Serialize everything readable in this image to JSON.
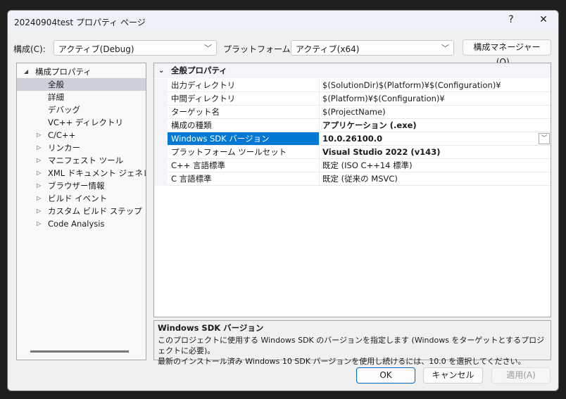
{
  "window": {
    "title": "20240904test プロパティ ページ",
    "help": "?",
    "close": "✕"
  },
  "config": {
    "label": "構成(C):",
    "value": "アクティブ(Debug)",
    "platform_label": "プラットフォーム(P):",
    "platform_value": "アクティブ(x64)",
    "manager_button": "構成マネージャー(O)..."
  },
  "tree": {
    "root": "構成プロパティ",
    "items": [
      {
        "label": "全般",
        "expandable": false,
        "selected": true
      },
      {
        "label": "詳細",
        "expandable": false
      },
      {
        "label": "デバッグ",
        "expandable": false
      },
      {
        "label": "VC++ ディレクトリ",
        "expandable": false
      },
      {
        "label": "C/C++",
        "expandable": true
      },
      {
        "label": "リンカー",
        "expandable": true
      },
      {
        "label": "マニフェスト ツール",
        "expandable": true
      },
      {
        "label": "XML ドキュメント ジェネレーター",
        "expandable": true
      },
      {
        "label": "ブラウザー情報",
        "expandable": true
      },
      {
        "label": "ビルド イベント",
        "expandable": true
      },
      {
        "label": "カスタム ビルド ステップ",
        "expandable": true
      },
      {
        "label": "Code Analysis",
        "expandable": true
      }
    ]
  },
  "grid": {
    "section": "全般プロパティ",
    "rows": [
      {
        "name": "出力ディレクトリ",
        "value": "$(SolutionDir)$(Platform)¥$(Configuration)¥",
        "bold": false
      },
      {
        "name": "中間ディレクトリ",
        "value": "$(Platform)¥$(Configuration)¥",
        "bold": false
      },
      {
        "name": "ターゲット名",
        "value": "$(ProjectName)",
        "bold": false
      },
      {
        "name": "構成の種類",
        "value": "アプリケーション (.exe)",
        "bold": true
      },
      {
        "name": "Windows SDK バージョン",
        "value": "10.0.26100.0",
        "bold": true,
        "selected": true
      },
      {
        "name": "プラットフォーム ツールセット",
        "value": "Visual Studio 2022 (v143)",
        "bold": true
      },
      {
        "name": "C++ 言語標準",
        "value": "既定 (ISO C++14 標準)",
        "bold": false
      },
      {
        "name": "C 言語標準",
        "value": "既定 (従来の MSVC)",
        "bold": false
      }
    ]
  },
  "description": {
    "title": "Windows SDK バージョン",
    "line1": "このプロジェクトに使用する Windows SDK のバージョンを指定します (Windows をターゲットとするプロジェクトに必要)。",
    "line2": "最新のインストール済み Windows 10 SDK バージョンを使用し続けるには、10.0 を選択してください。"
  },
  "buttons": {
    "ok": "OK",
    "cancel": "キャンセル",
    "apply": "適用(A)"
  },
  "colors": {
    "selection": "#0078d4",
    "tree_selection": "#cdcfdb"
  }
}
